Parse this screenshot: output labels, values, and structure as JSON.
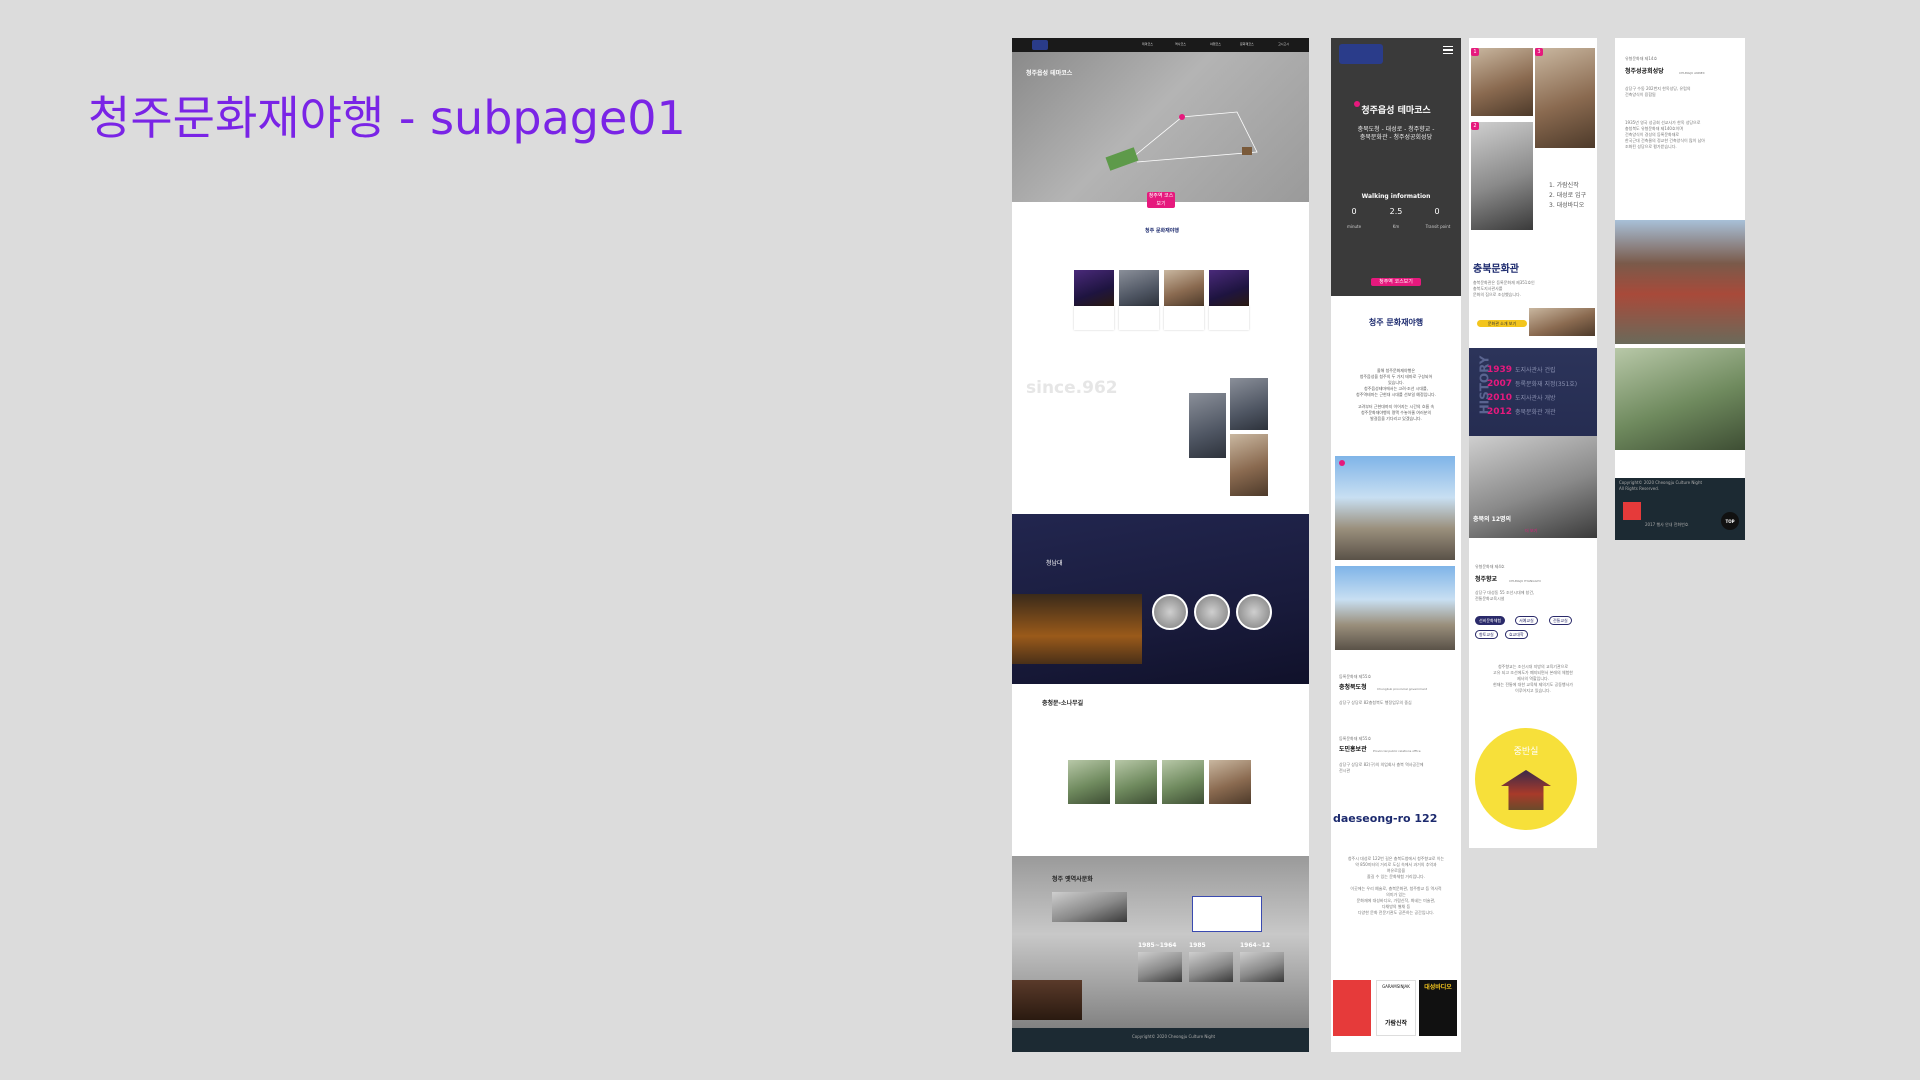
{
  "title": "청주문화재야행 - subpage01",
  "desktop": {
    "nav": [
      "테마코스",
      "역사코스",
      "야행코스",
      "문화재코스",
      "고시고시"
    ],
    "logo": "청주 문화재야행",
    "hero": {
      "heading": "청주읍성 테마코스",
      "button": "청주역 코스보기",
      "stats": [
        "0",
        "2.5",
        "0"
      ]
    },
    "since": "since.962",
    "section_nightscape": {
      "heading": "청남대"
    },
    "section_school": {
      "heading": "충청문-소나무길"
    },
    "section_station": {
      "heading": "청주 옛역사문화",
      "years": [
        "1985~1964",
        "1985",
        "1964~12"
      ]
    },
    "footer": "Copyright© 2020 Cheongju Culture Night"
  },
  "mobile1": {
    "hero": {
      "heading": "청주읍성 테마코스",
      "route": "충북도청 - 대성로 - 청주향교 -\n충북문화관 - 청주성공회성당",
      "walking_title": "Walking information",
      "stats": [
        {
          "value": "0",
          "unit": "minute"
        },
        {
          "value": "2.5",
          "unit": "Km"
        },
        {
          "value": "0",
          "unit": "Transit point"
        }
      ],
      "button": "청주역 코스보기"
    },
    "logo": "청주 문화재야행",
    "intro": "올해 청주문화재야행은\n청주읍성을 청주의 두 가지 테마로 구성되어\n있습니다.\n청주읍성테마에서는 고려·조선 시대를,\n청주역테마는 근현대 시대를 선보일 예정입니다.\n\n고려부터 근현대까지 이어지는 시간의 흐름 속\n청주문화재야행의 명맥 수놓아줄 여러분의\n발걸음을 기다리고 있겠습니다.",
    "place1": {
      "tag": "등록문화재 제55호",
      "name": "충청북도청",
      "en": "Chungbuk provincial government",
      "desc": "상당구 상당로 82충청북도 행정업무의 중심"
    },
    "place2": {
      "tag": "등록문화재 제55호",
      "name": "도민홍보관",
      "en": "Provincial public relations office",
      "desc": "상당구 상당로 82(구)의 의업회사 충북 역사공간에\n전시관"
    },
    "street": "daeseong-ro 122",
    "street_desc": "청주시 대성로 122번 길은 충북도청에서 청주향교로 이는\n약 850미터의 거리로 도심 속에서 과거의 추억과\n여유로움을\n즐길 수 있는 문화체험 거리입니다.\n\n이곳에는 우리 예술로, 충북문화관, 청주향교 등 역사적\n의미가 있는\n문화재에 대성바디오, 가람신작, 화네는 미술관,\n다채방의 별채 등\n다양한 문화 전문기관도 공존하는 공간입니다.",
    "posters": [
      "GARAMSINJAK",
      "가람신작",
      "대성바디오"
    ]
  },
  "mobile2": {
    "numbered": [
      "1",
      "3",
      "2"
    ],
    "list": [
      "1. 가람신작",
      "2. 대성로 입구",
      "3. 대성바디오"
    ],
    "place": {
      "name": "충북문화관",
      "desc": "충북문화관은 등록문화재 제351호인\n충북도지사관사를\n문화의 집으로 조성했습니다.",
      "button": "문화관 소개 보기"
    },
    "history_label": "HISTORY",
    "history": [
      {
        "year": "1939",
        "text": "도지사관사 건립"
      },
      {
        "year": "2007",
        "text": "등록문화재 지정(351호)"
      },
      {
        "year": "2010",
        "text": "도지사관사 개방"
      },
      {
        "year": "2012",
        "text": "충북문화관 개관"
      }
    ],
    "people_caption": "충북의 12명의",
    "more": "더 보기",
    "hyanggyo": {
      "tag": "유형문화재 제4호",
      "name": "청주향교",
      "en": "CHUNGJU HYANGGYO",
      "desc": "상당구 대성동 55 조선시대에 창건,\n전통문화교육시설"
    },
    "chips": [
      "선비문화체험",
      "서예교실",
      "전통교실",
      "향토교실",
      "효교대학"
    ],
    "hyanggyo_desc": "청주향교는 조선시대 지방의 교육기관으로\n고유 되고 조선에도가 폐지되면서 본래의 체험한\n제사의 역할입니다.\n현재는 전통에 대한 교육체 제의기도 공동행사가\n이루어지고 있습니다.",
    "circle_label": "중반실"
  },
  "mobile3": {
    "tag": "유형문화재 제14호",
    "name": "청주성공회성당",
    "en": "CHUNGJU ANNEX",
    "intro": "상당구 수동 202번지 한옥성당, 유럽의\n건축양식이 융합됨",
    "desc": "1935년 영국 성공회 선교사가 한옥 성당으로\n충청북도 유형문화재 제140호이며\n건축양식이 경성의 등록문화재로\n한국근대 건축물의 정교한 건축양식이 많이 남아\n조화된 성당으로 평가받습니다.",
    "footer": "Copyright© 2020 Cheongju Culture Night\nAll Rights Reserved.",
    "footer2": "2017 행사 안내 전화번호",
    "top": "TOP"
  },
  "colors": {
    "accent": "#7a24e6",
    "pink": "#e6197d",
    "yellow": "#f3c51d",
    "navy": "#1c2450"
  }
}
